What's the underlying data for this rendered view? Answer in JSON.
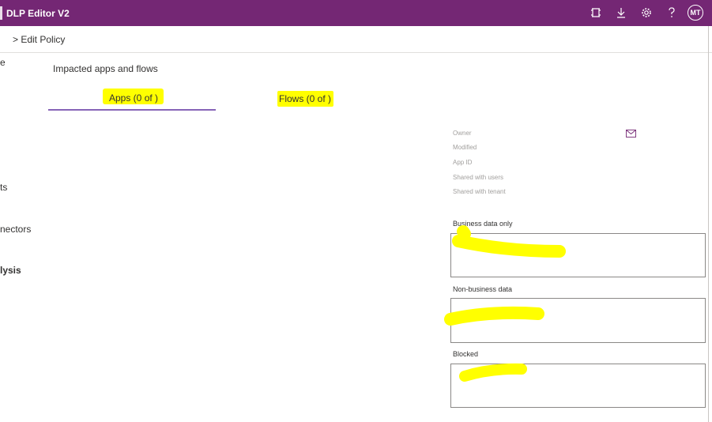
{
  "header": {
    "app_title": "DLP Editor V2",
    "avatar_initials": "MT",
    "icons": [
      "fit-screen-icon",
      "download-icon",
      "gear-icon",
      "help-icon"
    ]
  },
  "breadcrumb": "> Edit Policy",
  "left_nav": {
    "items": [
      {
        "label": "e"
      },
      {
        "label": "ts"
      },
      {
        "label": "nectors"
      },
      {
        "label": "lysis"
      }
    ]
  },
  "main": {
    "section_title": "Impacted apps and flows",
    "tabs": [
      {
        "label": "Apps (0 of )",
        "selected": true
      },
      {
        "label": "Flows (0 of )",
        "selected": false
      }
    ]
  },
  "details": {
    "owner_label": "Owner",
    "modified_label": "Modified",
    "app_id_label": "App ID",
    "shared_users_label": "Shared with users",
    "shared_tenant_label": "Shared with tenant"
  },
  "groups": {
    "business_label": "Business data only",
    "non_business_label": "Non-business data",
    "blocked_label": "Blocked"
  },
  "colors": {
    "header": "#742774",
    "tab_underline": "#8764b8",
    "highlight": "#ffff00"
  }
}
